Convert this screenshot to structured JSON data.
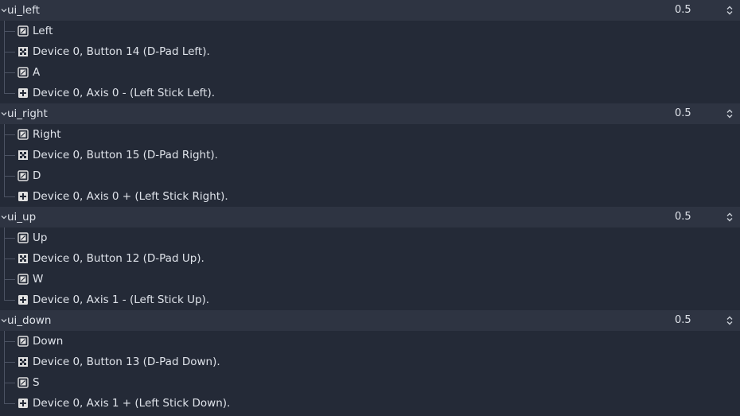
{
  "actions": [
    {
      "name": "ui_left",
      "deadzone": "0.5",
      "events": [
        {
          "type": "key",
          "icon": "keyboard-icon",
          "label": "Left"
        },
        {
          "type": "joy_button",
          "icon": "joypad-button-icon",
          "label": "Device 0, Button 14 (D-Pad Left)."
        },
        {
          "type": "key",
          "icon": "keyboard-icon",
          "label": "A"
        },
        {
          "type": "joy_axis",
          "icon": "joypad-axis-icon",
          "label": "Device 0, Axis 0 - (Left Stick Left)."
        }
      ]
    },
    {
      "name": "ui_right",
      "deadzone": "0.5",
      "events": [
        {
          "type": "key",
          "icon": "keyboard-icon",
          "label": "Right"
        },
        {
          "type": "joy_button",
          "icon": "joypad-button-icon",
          "label": "Device 0, Button 15 (D-Pad Right)."
        },
        {
          "type": "key",
          "icon": "keyboard-icon",
          "label": "D"
        },
        {
          "type": "joy_axis",
          "icon": "joypad-axis-icon",
          "label": "Device 0, Axis 0 + (Left Stick Right)."
        }
      ]
    },
    {
      "name": "ui_up",
      "deadzone": "0.5",
      "events": [
        {
          "type": "key",
          "icon": "keyboard-icon",
          "label": "Up"
        },
        {
          "type": "joy_button",
          "icon": "joypad-button-icon",
          "label": "Device 0, Button 12 (D-Pad Up)."
        },
        {
          "type": "key",
          "icon": "keyboard-icon",
          "label": "W"
        },
        {
          "type": "joy_axis",
          "icon": "joypad-axis-icon",
          "label": "Device 0, Axis 1 - (Left Stick Up)."
        }
      ]
    },
    {
      "name": "ui_down",
      "deadzone": "0.5",
      "events": [
        {
          "type": "key",
          "icon": "keyboard-icon",
          "label": "Down"
        },
        {
          "type": "joy_button",
          "icon": "joypad-button-icon",
          "label": "Device 0, Button 13 (D-Pad Down)."
        },
        {
          "type": "key",
          "icon": "keyboard-icon",
          "label": "S"
        },
        {
          "type": "joy_axis",
          "icon": "joypad-axis-icon",
          "label": "Device 0, Axis 1 + (Left Stick Down)."
        }
      ]
    }
  ]
}
